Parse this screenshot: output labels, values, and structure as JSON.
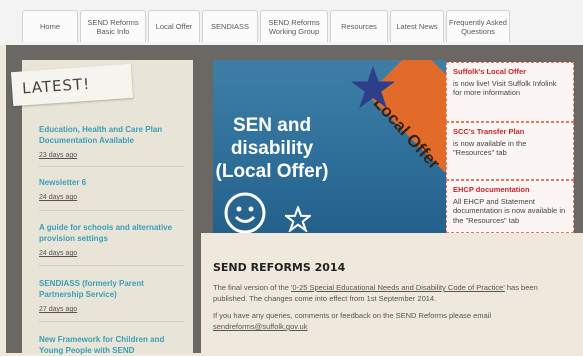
{
  "nav": {
    "items": [
      {
        "label": "Home"
      },
      {
        "label": "SEND Reforms\nBasic Info"
      },
      {
        "label": "Local Offer"
      },
      {
        "label": "SENDIASS"
      },
      {
        "label": "SEND Reforms\nWorking Group"
      },
      {
        "label": "Resources"
      },
      {
        "label": "Latest News"
      },
      {
        "label": "Frequently Asked\nQuestions"
      }
    ]
  },
  "latest": {
    "tag": "LATEST!",
    "items": [
      {
        "title": "Education, Health and Care Plan Documentation Available",
        "date": "23 days ago"
      },
      {
        "title": "Newsletter 6",
        "date": "24 days ago"
      },
      {
        "title": "A guide for schools and alternative provision settings",
        "date": "24 days ago"
      },
      {
        "title": "SENDIASS (formerly Parent Partnership Service)",
        "date": "27 days ago"
      },
      {
        "title": "New Framework for Children and Young People with SEND",
        "date": ""
      }
    ]
  },
  "banner": {
    "line1": "SEN and",
    "line2": "disability",
    "line3": "(Local Offer)",
    "ribbon": "Local Offer"
  },
  "info": [
    {
      "title": "Suffolk's Local Offer",
      "body": "is now live! Visit Suffolk Infolink for more information"
    },
    {
      "title": "SCC's Transfer Plan",
      "body": "is now available in the \"Resources\" tab"
    },
    {
      "title": "EHCP documentation",
      "body": "All EHCP and Statement documentation is now available in the \"Resources\" tab"
    }
  ],
  "content": {
    "heading": "SEND REFORMS 2014",
    "p1_before": "The final version of the ",
    "p1_link": "'0-25 Special Educational Needs and Disability Code of Practice'",
    "p1_after": " has been published. The changes come into effect from 1st September 2014.",
    "p2": "If you have any queries, comments or feedback on the SEND Reforms please email",
    "email": "sendreforms@suffolk.gov.uk"
  },
  "colors": {
    "accent": "#3a9fb6",
    "ribbon": "#e36b2a",
    "alert": "#c8262b",
    "banner": "#2d6e99"
  }
}
